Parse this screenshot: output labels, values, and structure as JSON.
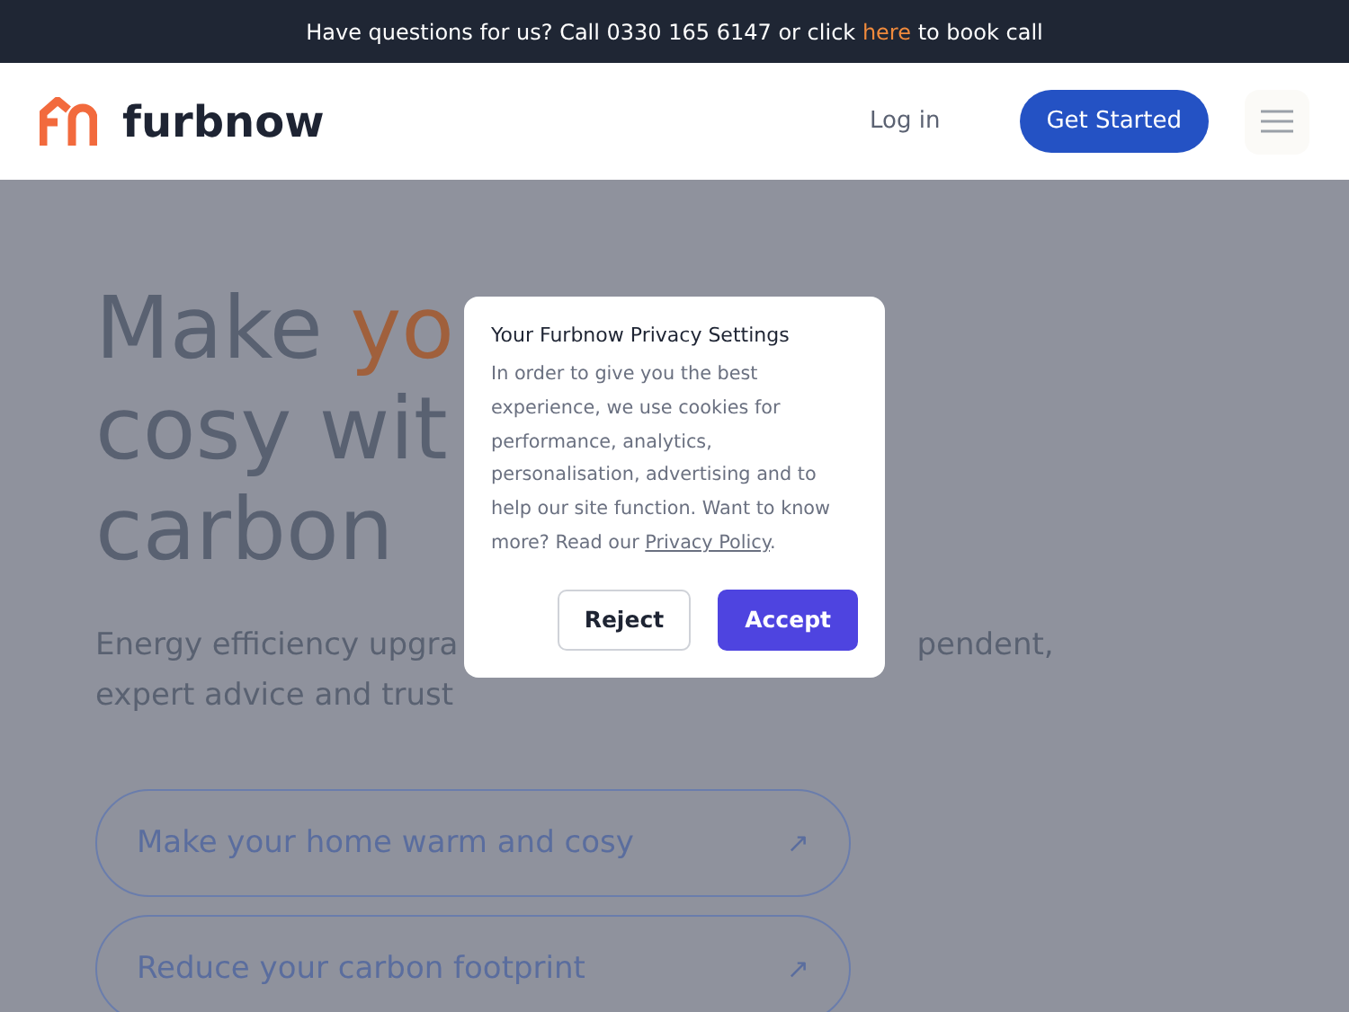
{
  "announcement": {
    "before": "Have questions for us? Call 0330 165 6147 or click",
    "link": "here",
    "after": "to book call"
  },
  "header": {
    "brand": "furbnow",
    "login": "Log in",
    "cta": "Get Started"
  },
  "hero": {
    "headline": [
      {
        "text": "Make ",
        "accent": false
      },
      {
        "text": "yo",
        "accent": true
      }
    ],
    "headline_lines": [
      "cosy wit",
      "carbon"
    ],
    "intro_lines": [
      {
        "left": "Energy efficiency upgra",
        "right": "pendent,"
      },
      {
        "left": "expert advice and trust"
      }
    ],
    "options": [
      {
        "label": "Make your home warm and cosy",
        "arrow": "↗"
      },
      {
        "label": "Reduce your carbon footprint",
        "arrow": "↗"
      }
    ]
  },
  "cookie_dialog": {
    "title": "Your Furbnow Privacy Settings",
    "body": "In order to give you the best experience, we use cookies for performance, analytics, personalisation, advertising and to help our site function. Want to know more? Read our",
    "link": "Privacy Policy",
    "after_link": ".",
    "buttons": [
      {
        "label": "Reject",
        "kind": "secondary"
      },
      {
        "label": "Accept",
        "kind": "primary"
      }
    ]
  }
}
